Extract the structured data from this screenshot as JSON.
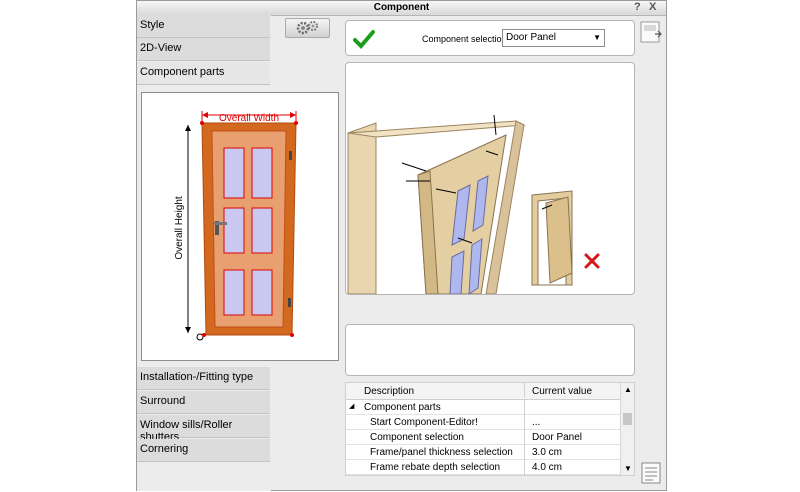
{
  "window": {
    "title": "Component",
    "help_label": "?",
    "close_label": "X"
  },
  "nav": {
    "style": "Style",
    "view2d": "2D-View",
    "component_parts": "Component parts",
    "installation": "Installation-/Fitting type",
    "surround": "Surround",
    "window_sills": "Window sills/Roller shutters",
    "cornering": "Cornering"
  },
  "preview": {
    "overall_width": "Overall Width",
    "overall_height": "Overall Height"
  },
  "component_selection": {
    "label": "Component selection:",
    "value": "Door Panel"
  },
  "table": {
    "headers": {
      "description": "Description",
      "current_value": "Current value"
    },
    "rows": [
      {
        "desc": "Component parts",
        "value": ""
      },
      {
        "desc": "Start Component-Editor!",
        "value": "..."
      },
      {
        "desc": "Component selection",
        "value": "Door Panel"
      },
      {
        "desc": "Frame/panel thickness selection",
        "value": "3.0 cm"
      },
      {
        "desc": "Frame rebate depth selection",
        "value": "4.0 cm"
      }
    ]
  },
  "icons": {
    "confirm": "checkmark-icon",
    "settings": "gear-icon",
    "cancel": "red-x-icon",
    "expand": "collapse-tree-icon",
    "panel_toggle": "panel-toggle-icon",
    "notes": "notes-icon"
  },
  "colors": {
    "door_wood": "#e8a070",
    "door_frame": "#d2691e",
    "dimension_red": "#e00000",
    "glass": "#c8c8f0",
    "check_green": "#1e9e1e"
  }
}
